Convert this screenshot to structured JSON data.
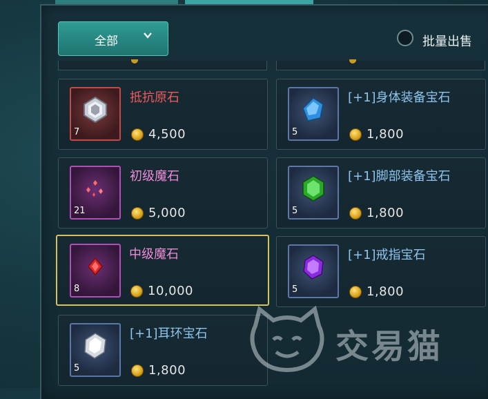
{
  "filter": {
    "label": "全部"
  },
  "bulk_sell": {
    "label": "批量出售"
  },
  "items": [
    {
      "name": "抵抗原石",
      "count": "7",
      "price": "4,500",
      "name_color": "#f05a5a",
      "rarity": "red",
      "icon": "silver-ore-icon"
    },
    {
      "name": "[+1]身体装备宝石",
      "count": "5",
      "price": "1,800",
      "name_color": "#8cc4ec",
      "rarity": "blue",
      "icon": "blue-gem-icon"
    },
    {
      "name": "初级魔石",
      "count": "21",
      "price": "5,000",
      "name_color": "#f08ad8",
      "rarity": "purple",
      "icon": "red-sparkle-shards-icon"
    },
    {
      "name": "[+1]脚部装备宝石",
      "count": "5",
      "price": "1,800",
      "name_color": "#8cc4ec",
      "rarity": "blue",
      "icon": "green-gem-icon"
    },
    {
      "name": "中级魔石",
      "count": "8",
      "price": "10,000",
      "name_color": "#f08ad8",
      "rarity": "purple",
      "icon": "red-crystal-icon",
      "selected": true
    },
    {
      "name": "[+1]戒指宝石",
      "count": "5",
      "price": "1,800",
      "name_color": "#8cc4ec",
      "rarity": "blue",
      "icon": "purple-gem-icon"
    },
    {
      "name": "[+1]耳环宝石",
      "count": "5",
      "price": "1,800",
      "name_color": "#8cc4ec",
      "rarity": "blue",
      "icon": "white-gem-icon"
    }
  ],
  "watermark": {
    "text": "交易猫"
  }
}
